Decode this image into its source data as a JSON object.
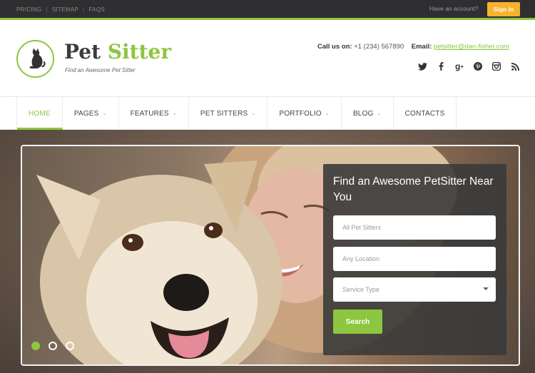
{
  "topbar": {
    "links": [
      "PRICING",
      "SITEMAP",
      "FAQS"
    ],
    "have_account": "Have an account?",
    "signin_label": "Sign In"
  },
  "header": {
    "logo_word1": "Pet",
    "logo_word2": "Sitter",
    "tagline": "Find an Awesome Pet Sitter",
    "call_label": "Call us on:",
    "phone": "+1 (234) 567890",
    "email_label": "Email:",
    "email": "petsitter@dan-fisher.com",
    "socials": [
      "twitter-icon",
      "facebook-icon",
      "google-plus-icon",
      "pinterest-icon",
      "instagram-icon",
      "rss-icon"
    ]
  },
  "nav": {
    "items": [
      {
        "label": "HOME",
        "dropdown": false
      },
      {
        "label": "PAGES",
        "dropdown": true
      },
      {
        "label": "FEATURES",
        "dropdown": true
      },
      {
        "label": "PET SITTERS",
        "dropdown": true
      },
      {
        "label": "PORTFOLIO",
        "dropdown": true
      },
      {
        "label": "BLOG",
        "dropdown": true
      },
      {
        "label": "CONTACTS",
        "dropdown": false
      }
    ]
  },
  "search": {
    "title": "Find an Awesome PetSitter Near You",
    "sitters_placeholder": "All Pet Sitters",
    "location_placeholder": "Any Location",
    "service_type": "Service Type",
    "button_label": "Search"
  },
  "slider": {
    "dot_count": 3,
    "active_index": 0
  },
  "colors": {
    "accent": "#8dc63f",
    "signin": "#f7b32b",
    "topbar": "#2f2f31"
  }
}
